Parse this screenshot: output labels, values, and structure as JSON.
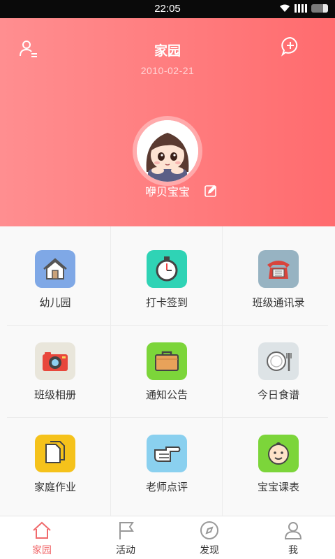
{
  "status_bar": {
    "time": "22:05"
  },
  "header": {
    "title": "家园",
    "date": "2010-02-21",
    "nickname": "咿贝宝宝"
  },
  "colors": {
    "accent": "#f06a6c",
    "header": "#ff7a7c"
  },
  "grid": {
    "items": [
      {
        "label": "幼儿园",
        "icon": "house-icon",
        "bg": "#7fa8e6"
      },
      {
        "label": "打卡签到",
        "icon": "stopwatch-icon",
        "bg": "#2fd3b5"
      },
      {
        "label": "班级通讯录",
        "icon": "telephone-icon",
        "bg": "#97b3c2"
      },
      {
        "label": "班级相册",
        "icon": "camera-icon",
        "bg": "#e9e6db"
      },
      {
        "label": "通知公告",
        "icon": "briefcase-icon",
        "bg": "#7cd53a"
      },
      {
        "label": "今日食谱",
        "icon": "plate-fork-icon",
        "bg": "#dde3e6"
      },
      {
        "label": "家庭作业",
        "icon": "documents-icon",
        "bg": "#f5c21b"
      },
      {
        "label": "老师点评",
        "icon": "pointing-hand-icon",
        "bg": "#8ad0ef"
      },
      {
        "label": "宝宝课表",
        "icon": "baby-face-icon",
        "bg": "#7cd53a"
      }
    ]
  },
  "bottom_nav": {
    "items": [
      {
        "label": "家园",
        "icon": "home-icon",
        "active": true
      },
      {
        "label": "活动",
        "icon": "flag-icon",
        "active": false
      },
      {
        "label": "发现",
        "icon": "compass-icon",
        "active": false
      },
      {
        "label": "我",
        "icon": "person-icon",
        "active": false
      }
    ]
  }
}
